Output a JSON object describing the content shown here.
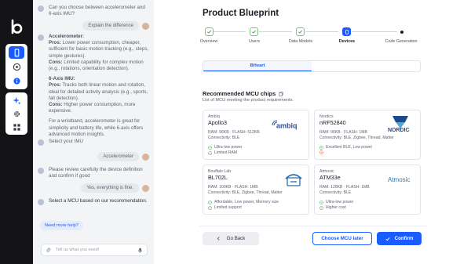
{
  "nav": {
    "logo": "b",
    "top_group": [
      {
        "icon": "phone-icon",
        "active": true
      },
      {
        "icon": "compass-icon",
        "active": false
      },
      {
        "icon": "info-icon",
        "active": false
      }
    ],
    "bottom_group": [
      {
        "icon": "sparkle-icon",
        "active": false
      },
      {
        "icon": "gear-icon",
        "active": false
      },
      {
        "icon": "grid-icon",
        "active": false
      }
    ]
  },
  "chat": {
    "q1": "Can you choose between accelerometer and 6-axis IMU?",
    "a1": "Explain the difference",
    "accel_head": "Accelerometer:",
    "accel_pros_label": "Pros:",
    "accel_pros": "Lower power consumption, cheaper, sufficient for basic motion tracking (e.g., steps, simple gestures).",
    "accel_cons_label": "Cons:",
    "accel_cons": "Limited capability for complex motion (e.g., rotations, orientation detection).",
    "imu_head": "6-Axis IMU:",
    "imu_pros_label": "Pros:",
    "imu_pros": "Tracks both linear motion and rotation, ideal for detailed activity analysis (e.g., sports, fall detection).",
    "imu_cons_label": "Cons:",
    "imu_cons": "Higher power consumption, more expensive.",
    "summary": "For a wristband, accelerometer is great for simplicity and battery life, while 6-axis offers advanced motion insights.",
    "q2": "Select your IMU",
    "a2": "Accelerometer",
    "q3": "Please review carefully the device definition and confirm if good",
    "a3": "Yes, everything is fine.",
    "q4": "Select a MCU based on our recommendation.",
    "help": "Need more help?",
    "input_placeholder": "Tell us what you need!"
  },
  "main": {
    "title": "Product Blueprint",
    "steps": [
      {
        "label": "Overview",
        "state": "done"
      },
      {
        "label": "Users",
        "state": "done"
      },
      {
        "label": "Data Models",
        "state": "done"
      },
      {
        "label": "Devices",
        "state": "current"
      },
      {
        "label": "Code Generation",
        "state": "pending"
      }
    ],
    "tabs": [
      {
        "label": "BHeart",
        "active": true
      },
      {
        "label": "",
        "active": false
      }
    ],
    "section_title": "Recommended MCU chips",
    "section_sub": "List of MCU meeting the product requirements.",
    "cards": [
      {
        "vendor": "Ambiq",
        "chip": "Apollo3",
        "spec1": "RAM: 96KB · FLASH: 512KB",
        "spec2": "Connectivity: BLE",
        "pro": "Ultra-low power",
        "con": "Limited RAM",
        "brand": "ambiq"
      },
      {
        "vendor": "Nordics",
        "chip": "nRF52840",
        "spec1": "RAM: 96KB · FLASH: 1MB",
        "spec2": "Connectivity: BLE, Zigbee, Thread, Matter",
        "pro": "Excellent BLE, Low power",
        "con": "",
        "brand": "NORDIC"
      },
      {
        "vendor": "Bouffalo Lab",
        "chip": "BL702L",
        "spec1": "RAM: 100KB · FLASH: 1MB",
        "spec2": "Connectivity: BLE, Zigbee, Thread, Matter",
        "pro": "Affordable, Low power, Memory size",
        "con": "Limited support",
        "brand": ""
      },
      {
        "vendor": "Atmosic",
        "chip": "ATM33e",
        "spec1": "RAM: 128KB · FLASH: 1MB",
        "spec2": "Connectivity: BLE",
        "pro": "Ultra-low power",
        "con": "Higher cost",
        "brand": "Atmosic"
      }
    ],
    "back_label": "Go Back",
    "later_label": "Choose MCU later",
    "confirm_label": "Confirm"
  },
  "colors": {
    "accent": "#1a5cff",
    "success": "#3aa655",
    "danger": "#e0533d",
    "rail": "#141417",
    "chat_bg": "#f3f4f6"
  }
}
